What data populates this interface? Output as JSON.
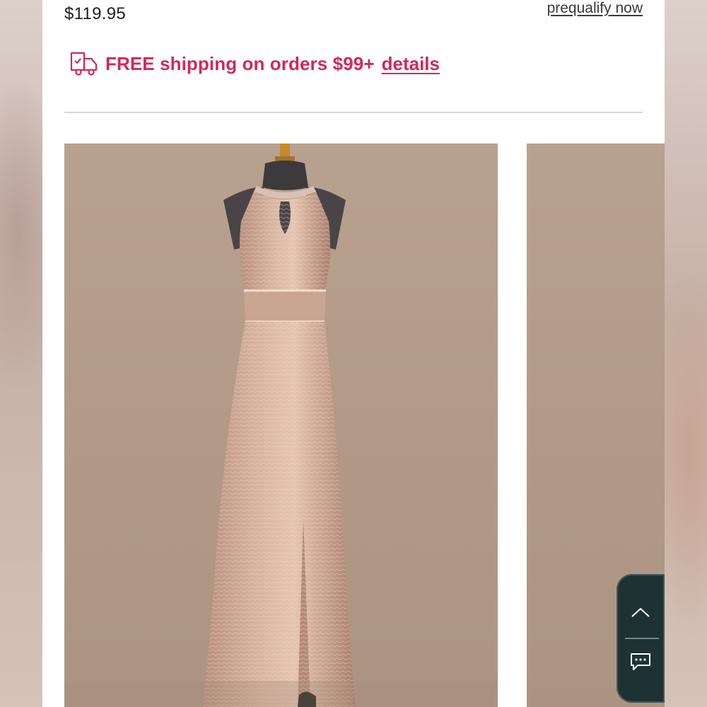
{
  "product": {
    "price": "$119.95",
    "prequalify_link": "prequalify now"
  },
  "shipping": {
    "icon": "delivery-truck-icon",
    "message": "FREE shipping on orders $99+",
    "details_link": "details"
  },
  "gallery": {
    "images": [
      {
        "name": "dress-front-view",
        "description_hidden": true
      },
      {
        "name": "dress-next-view",
        "description_hidden": true
      }
    ]
  },
  "floating_actions": {
    "scroll_top_icon": "chevron-up-icon",
    "chat_icon": "chat-bubble-icon"
  },
  "colors": {
    "accent": "#d2285b",
    "panel": "#1f3233",
    "photo_bg": "#b39a88"
  }
}
